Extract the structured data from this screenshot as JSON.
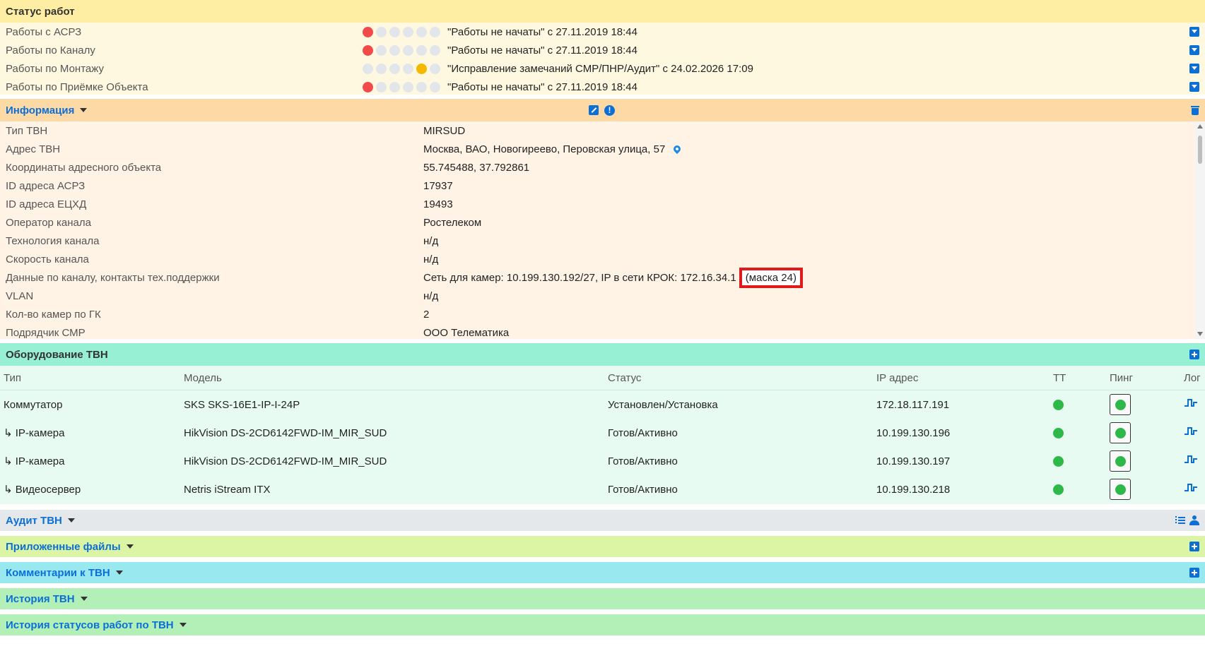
{
  "status": {
    "title": "Статус работ",
    "rows": [
      {
        "label": "Работы с АСРЗ",
        "text": "\"Работы не начаты\" с 27.11.2019 18:44",
        "active_dot": 1,
        "active_color": "#f04a4a"
      },
      {
        "label": "Работы по Каналу",
        "text": "\"Работы не начаты\" с 27.11.2019 18:44",
        "active_dot": 1,
        "active_color": "#f04a4a"
      },
      {
        "label": "Работы по Монтажу",
        "text": "\"Исправление замечаний СМР/ПНР/Аудит\" с 24.02.2026 17:09",
        "active_dot": 5,
        "active_color": "#f5b800"
      },
      {
        "label": "Работы по Приёмке Объекта",
        "text": "\"Работы не начаты\" с 27.11.2019 18:44",
        "active_dot": 1,
        "active_color": "#f04a4a"
      }
    ]
  },
  "info": {
    "title": "Информация",
    "rows": [
      {
        "label": "Тип ТВН",
        "value": "MIRSUD"
      },
      {
        "label": "Адрес ТВН",
        "value": "Москва, ВАО, Новогиреево, Перовская улица, 57"
      },
      {
        "label": "Координаты адресного объекта",
        "value": "55.745488, 37.792861"
      },
      {
        "label": "ID адреса АСРЗ",
        "value": "17937"
      },
      {
        "label": "ID адреса ЕЦХД",
        "value": "19493"
      },
      {
        "label": "Оператор канала",
        "value": "Ростелеком"
      },
      {
        "label": "Технология канала",
        "value": "н/д"
      },
      {
        "label": "Скорость канала",
        "value": "н/д"
      },
      {
        "label": "Данные по каналу, контакты тех.поддержки",
        "value": "Сеть для камер: 10.199.130.192/27, IP в сети КРОК: 172.16.34.1",
        "highlight": "(маска 24)"
      },
      {
        "label": "VLAN",
        "value": "н/д"
      },
      {
        "label": "Кол-во камер по ГК",
        "value": "2"
      },
      {
        "label": "Подрядчик СМР",
        "value": "ООО Телематика"
      }
    ]
  },
  "equipment": {
    "title": "Оборудование ТВН",
    "columns": {
      "type": "Тип",
      "model": "Модель",
      "status": "Статус",
      "ip": "IP адрес",
      "tt": "ТТ",
      "ping": "Пинг",
      "log": "Лог"
    },
    "rows": [
      {
        "type": "Коммутатор",
        "model": "SKS SKS-16E1-IP-I-24P",
        "status": "Установлен/Установка",
        "ip": "172.18.117.191"
      },
      {
        "type": "↳ IP-камера",
        "model": "HikVision DS-2CD6142FWD-IM_MIR_SUD",
        "status": "Готов/Активно",
        "ip": "10.199.130.196"
      },
      {
        "type": "↳ IP-камера",
        "model": "HikVision DS-2CD6142FWD-IM_MIR_SUD",
        "status": "Готов/Активно",
        "ip": "10.199.130.197"
      },
      {
        "type": "↳ Видеосервер",
        "model": "Netris iStream ITX",
        "status": "Готов/Активно",
        "ip": "10.199.130.218"
      }
    ]
  },
  "sections": {
    "audit": "Аудит ТВН",
    "files": "Приложенные файлы",
    "comments": "Комментарии к ТВН",
    "history": "История ТВН",
    "status_history": "История статусов работ по ТВН"
  },
  "colors": {
    "accent": "#0b6fd6",
    "ok": "#2fb84a",
    "highlight_border": "#e0191b"
  }
}
